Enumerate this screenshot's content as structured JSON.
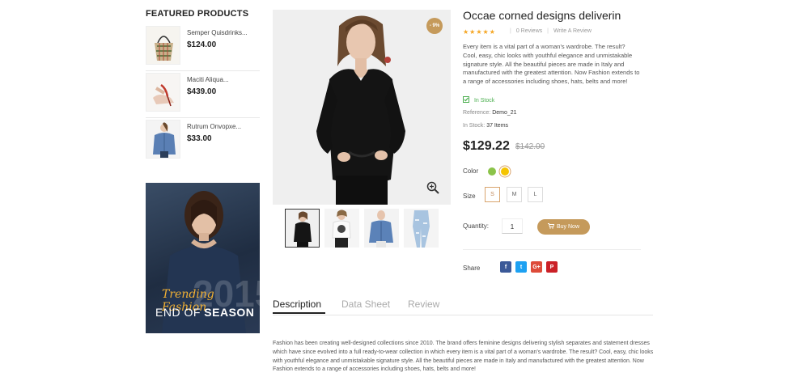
{
  "sidebar": {
    "featured_title": "FEATURED PRODUCTS",
    "products": [
      {
        "name": "Semper Quisdrinks...",
        "price": "$124.00",
        "thumb": "handbag-image"
      },
      {
        "name": "Maciti Aliqua...",
        "price": "$439.00",
        "thumb": "heels-image"
      },
      {
        "name": "Rutrum Onvopxe...",
        "price": "$33.00",
        "thumb": "denim-jacket-image"
      }
    ],
    "banner": {
      "year": "2015",
      "tagline": "Trending Fashion",
      "headline_prefix": "END OF",
      "headline_strong": "SEASON"
    }
  },
  "gallery": {
    "discount_badge": "- 9%",
    "thumbnails": [
      "black-top",
      "white-tee",
      "denim-jacket",
      "ripped-jeans"
    ]
  },
  "product": {
    "title": "Occae corned designs deliverin",
    "rating_stars": "★★★★★",
    "reviews_count": "0 Reviews",
    "write_review": "Write A Review",
    "description": "Every item is a vital part of a woman's wardrobe. The result? Cool, easy, chic looks with youthful elegance and unmistakable signature style. All the beautiful pieces are made in Italy and manufactured with the greatest attention. Now Fashion extends to a range of accessories including shoes, hats, belts and more!",
    "availability": "In Stock",
    "reference_label": "Reference:",
    "reference_value": "Demo_21",
    "instock_label": "In Stock:",
    "instock_value": "37 Items",
    "price": "$129.22",
    "old_price": "$142.00",
    "color_label": "Color",
    "colors": [
      "#8bc34a",
      "#f5c400"
    ],
    "size_label": "Size",
    "sizes": [
      "S",
      "M",
      "L"
    ],
    "selected_size": "S",
    "quantity_label": "Quantity:",
    "quantity_value": "1",
    "buy_label": "Buy Now",
    "share_label": "Share",
    "share_buttons": [
      {
        "icon": "facebook-icon",
        "glyph": "f",
        "color": "#3b5998"
      },
      {
        "icon": "twitter-icon",
        "glyph": "t",
        "color": "#1da1f2"
      },
      {
        "icon": "google-plus-icon",
        "glyph": "G+",
        "color": "#dd4b39"
      },
      {
        "icon": "pinterest-icon",
        "glyph": "P",
        "color": "#cb2027"
      }
    ]
  },
  "tabs": {
    "items": [
      "Description",
      "Data Sheet",
      "Review"
    ],
    "active": "Description",
    "content": "Fashion has been creating well-designed collections since 2010. The brand offers feminine designs delivering stylish separates and statement dresses which have since evolved into a full ready-to-wear collection in which every item is a vital part of a woman's wardrobe. The result? Cool, easy, chic looks with youthful elegance and unmistakable signature style. All the beautiful pieces are made in Italy and manufactured with the greatest attention. Now Fashion extends to a range of accessories including shoes, hats, belts and more!"
  },
  "colors": {
    "accent": "#c59a5b",
    "stock_green": "#4caf50",
    "star": "#f5a623"
  }
}
